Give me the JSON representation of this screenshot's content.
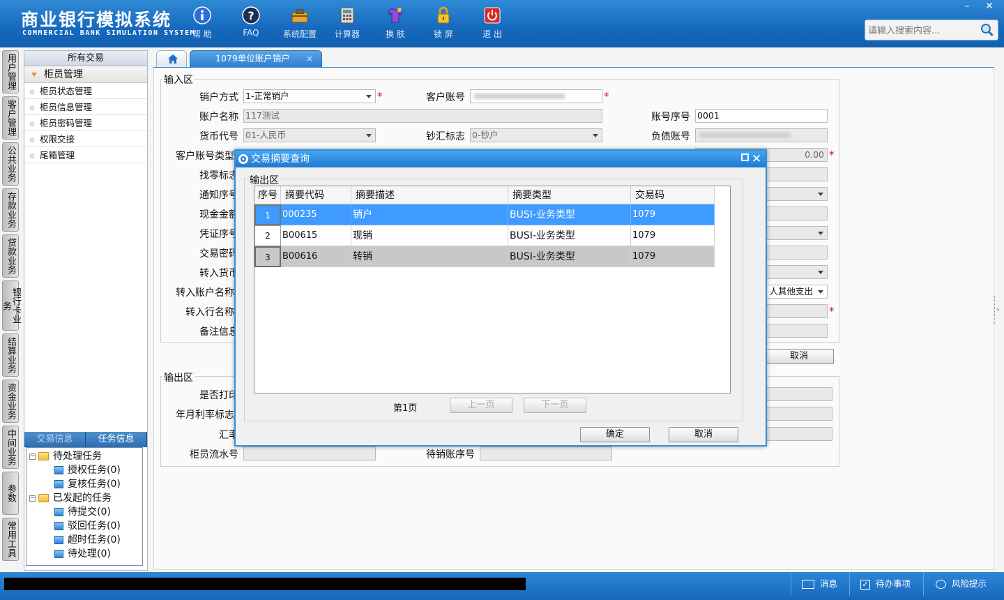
{
  "app": {
    "title_cn": "商业银行模拟系统",
    "title_en": "COMMERCIAL BANK SIMULATION SYSTEM"
  },
  "toolbar": [
    {
      "label": "帮 助",
      "icon": "info-icon"
    },
    {
      "label": "FAQ",
      "icon": "question-icon"
    },
    {
      "label": "系统配置",
      "icon": "toolbox-icon"
    },
    {
      "label": "计算器",
      "icon": "calculator-icon"
    },
    {
      "label": "换 肤",
      "icon": "shirt-icon"
    },
    {
      "label": "锁 屏",
      "icon": "lock-icon"
    },
    {
      "label": "退 出",
      "icon": "power-icon"
    }
  ],
  "window_controls": {
    "minimize": "–",
    "close": "✕"
  },
  "search": {
    "placeholder": "请输入搜索内容..."
  },
  "module_tabs": [
    "用户管理",
    "客户管理",
    "公共业务",
    "存款业务",
    "贷款业务",
    "银行卡业务",
    "结算业务",
    "资金业务",
    "中间业务",
    "参数",
    "常用工具"
  ],
  "left_panel": {
    "header": "所有交易",
    "group": "柜员管理",
    "items": [
      "柜员状态管理",
      "柜员信息管理",
      "柜员密码管理",
      "权限交接",
      "尾箱管理"
    ],
    "tabs": [
      "交易信息",
      "任务信息"
    ],
    "tree": {
      "pending": "待处理任务",
      "pending_children": [
        "授权任务(0)",
        "复核任务(0)"
      ],
      "initiated": "已发起的任务",
      "initiated_children": [
        "待提交(0)",
        "驳回任务(0)",
        "超时任务(0)",
        "待处理(0)"
      ]
    }
  },
  "tabs": {
    "active": "1079单位账户销户",
    "close": "×"
  },
  "input_area": {
    "title": "输入区",
    "labels": {
      "close_method": "销户方式",
      "customer_account": "客户账号",
      "account_name": "账户名称",
      "account_seq": "账号序号",
      "currency": "货币代号",
      "cash_flag": "钞汇标志",
      "debt_account": "负债账号",
      "account_type": "客户账号类型",
      "change_flag": "找零标志",
      "notice_no": "通知序号",
      "cash_amount": "现金金额",
      "voucher_no": "凭证序号",
      "tx_password": "交易密码",
      "to_currency": "转入货币",
      "to_account_name": "转入账户名称",
      "to_bank_name": "转入行名称",
      "remarks": "备注信息"
    },
    "values": {
      "close_method": "1-正常销户",
      "account_name": "117测试",
      "account_seq": "0001",
      "currency": "01-人民币",
      "cash_flag": "0-钞户",
      "amount": "0.00",
      "to_account_type": "人其他支出"
    },
    "cancel": "取消"
  },
  "output_area": {
    "title": "输出区",
    "labels": {
      "print_flag": "是否打印",
      "rate_flag": "年月利率标志",
      "exchange_rate": "汇率",
      "teller_seq": "柜员流水号",
      "pending_close_account": "待销账序号"
    }
  },
  "modal": {
    "title": "交易摘要查询",
    "area_title": "输出区",
    "columns": [
      "序号",
      "摘要代码",
      "摘要描述",
      "摘要类型",
      "交易码"
    ],
    "rows": [
      {
        "no": "1",
        "code": "000235",
        "desc": "销户",
        "type": "BUSI-业务类型",
        "tx_code": "1079"
      },
      {
        "no": "2",
        "code": "B00615",
        "desc": "现销",
        "type": "BUSI-业务类型",
        "tx_code": "1079"
      },
      {
        "no": "3",
        "code": "B00616",
        "desc": "转销",
        "type": "BUSI-业务类型",
        "tx_code": "1079"
      }
    ],
    "page_info": "第1页",
    "prev": "上一页",
    "next": "下一页",
    "confirm": "确定",
    "cancel": "取消"
  },
  "status_bar": {
    "messages": "消息",
    "todo": "待办事项",
    "risk": "风险提示"
  },
  "colors": {
    "header_blue": "#1669bd",
    "selected_row": "#3f9bff",
    "alt_row": "#c8c8c8",
    "required": "#d11111"
  }
}
